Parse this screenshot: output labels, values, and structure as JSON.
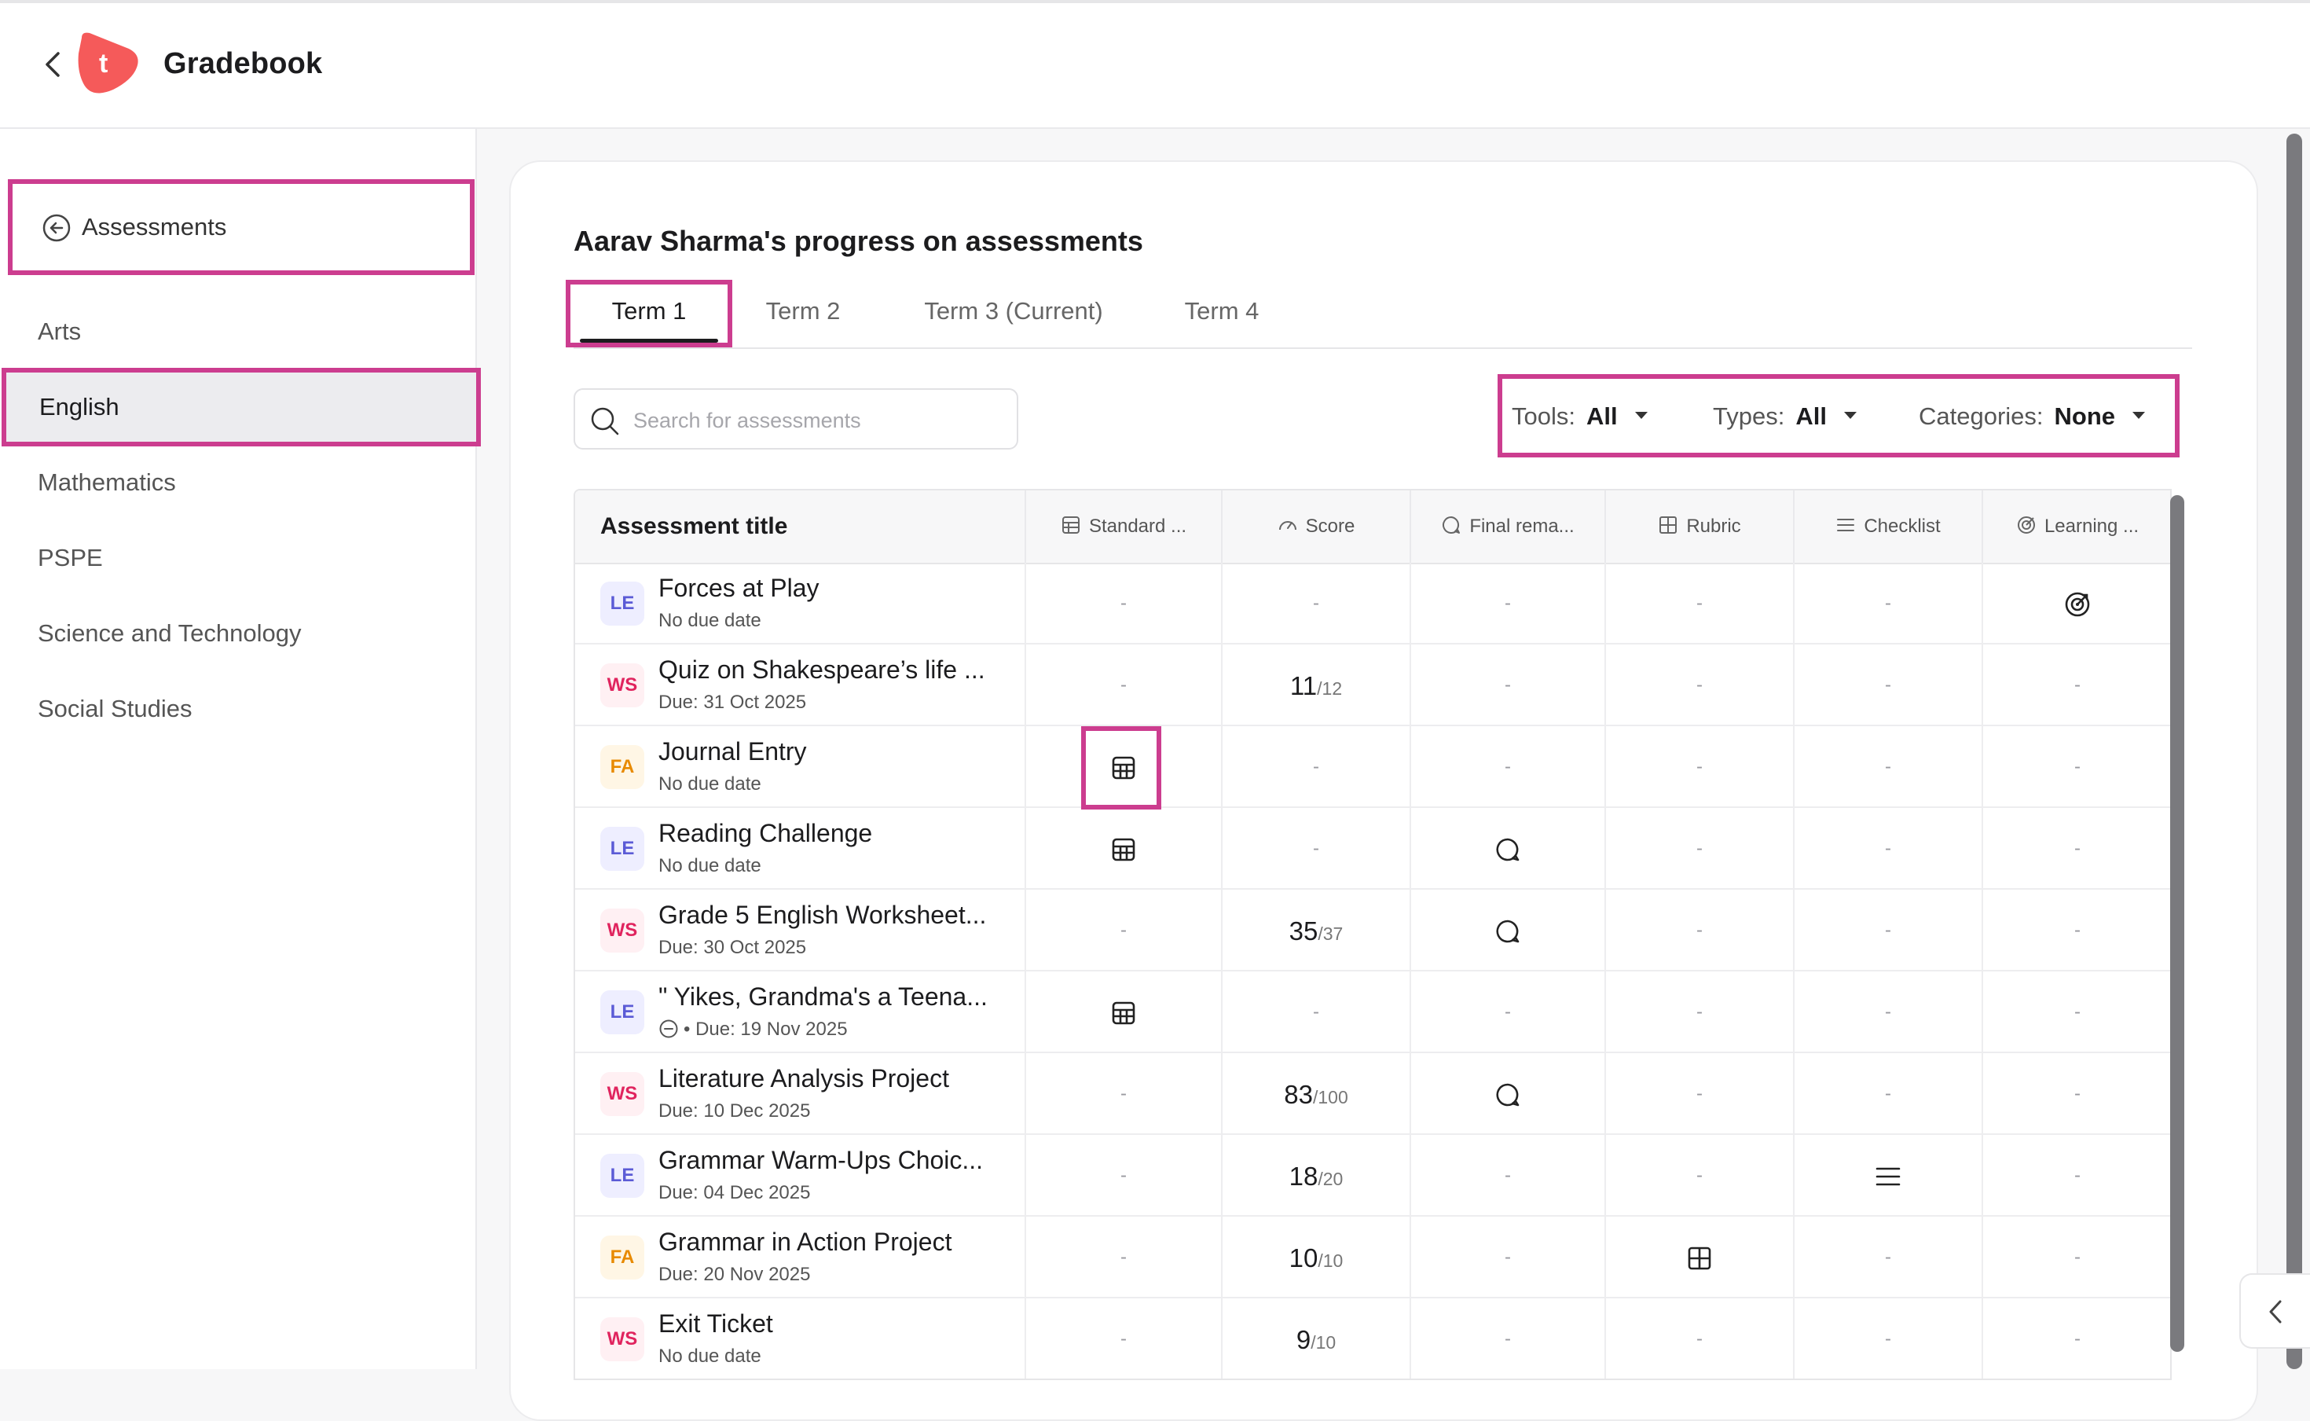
{
  "header": {
    "title": "Gradebook",
    "logo_letter": "t",
    "brand_color": "#f55a5a"
  },
  "sidebar": {
    "back_label": "Assessments",
    "items": [
      {
        "label": "Arts"
      },
      {
        "label": "English"
      },
      {
        "label": "Mathematics"
      },
      {
        "label": "PSPE"
      },
      {
        "label": "Science and Technology"
      },
      {
        "label": "Social Studies"
      }
    ],
    "active_item": "English"
  },
  "main": {
    "title": "Aarav Sharma's progress on assessments",
    "tabs": [
      {
        "label": "Term 1"
      },
      {
        "label": "Term 2"
      },
      {
        "label": "Term 3 (Current)"
      },
      {
        "label": "Term 4"
      }
    ],
    "active_tab": "Term 1",
    "search": {
      "placeholder": "Search for assessments",
      "value": ""
    },
    "filters": {
      "tools": {
        "label": "Tools:",
        "value": "All"
      },
      "types": {
        "label": "Types:",
        "value": "All"
      },
      "categories": {
        "label": "Categories:",
        "value": "None"
      }
    }
  },
  "table": {
    "headers": {
      "title": "Assessment title",
      "standard": "Standard ...",
      "score": "Score",
      "final": "Final rema...",
      "rubric": "Rubric",
      "checklist": "Checklist",
      "learning": "Learning ..."
    },
    "rows": [
      {
        "badge": "LE",
        "title": "Forces at Play",
        "due": "No due date",
        "standard": "-",
        "score": "-",
        "score_total": "",
        "final": "-",
        "rubric": "-",
        "checklist": "-",
        "learning": "target-icon"
      },
      {
        "badge": "WS",
        "title": "Quiz on Shakespeare’s life ...",
        "due": "Due: 31 Oct 2025",
        "standard": "-",
        "score": "11",
        "score_total": "/12",
        "final": "-",
        "rubric": "-",
        "checklist": "-",
        "learning": "-"
      },
      {
        "badge": "FA",
        "title": "Journal Entry",
        "due": "No due date",
        "standard": "table-icon",
        "score": "-",
        "score_total": "",
        "final": "-",
        "rubric": "-",
        "checklist": "-",
        "learning": "-"
      },
      {
        "badge": "LE",
        "title": "Reading Challenge",
        "due": "No due date",
        "standard": "table-icon",
        "score": "-",
        "score_total": "",
        "final": "comment-icon",
        "rubric": "-",
        "checklist": "-",
        "learning": "-"
      },
      {
        "badge": "WS",
        "title": "Grade 5 English Worksheet...",
        "due": "Due: 30 Oct 2025",
        "standard": "-",
        "score": "35",
        "score_total": "/37",
        "final": "comment-icon",
        "rubric": "-",
        "checklist": "-",
        "learning": "-"
      },
      {
        "badge": "LE",
        "title": "\" Yikes, Grandma's a Teena...",
        "due": "• Due: 19 Nov 2025",
        "due_icon": "minus-circle-icon",
        "standard": "table-icon",
        "score": "-",
        "score_total": "",
        "final": "-",
        "rubric": "-",
        "checklist": "-",
        "learning": "-"
      },
      {
        "badge": "WS",
        "title": "Literature Analysis Project",
        "due": "Due: 10 Dec 2025",
        "standard": "-",
        "score": "83",
        "score_total": "/100",
        "final": "comment-icon",
        "rubric": "-",
        "checklist": "-",
        "learning": "-"
      },
      {
        "badge": "LE",
        "title": "Grammar Warm-Ups Choic...",
        "due": "Due: 04 Dec 2025",
        "standard": "-",
        "score": "18",
        "score_total": "/20",
        "final": "-",
        "rubric": "-",
        "checklist": "list-icon",
        "learning": "-"
      },
      {
        "badge": "FA",
        "title": "Grammar in Action Project",
        "due": "Due: 20 Nov 2025",
        "standard": "-",
        "score": "10",
        "score_total": "/10",
        "final": "-",
        "rubric": "grid-icon",
        "checklist": "-",
        "learning": "-"
      },
      {
        "badge": "WS",
        "title": "Exit Ticket",
        "due": "No due date",
        "standard": "-",
        "score": "9",
        "score_total": "/10",
        "final": "-",
        "rubric": "-",
        "checklist": "-",
        "learning": "-"
      }
    ]
  },
  "colors": {
    "highlight": "#cc3d8f",
    "badge_le": "#5b5bd6",
    "badge_ws": "#e0245e",
    "badge_fa": "#e88a00"
  }
}
